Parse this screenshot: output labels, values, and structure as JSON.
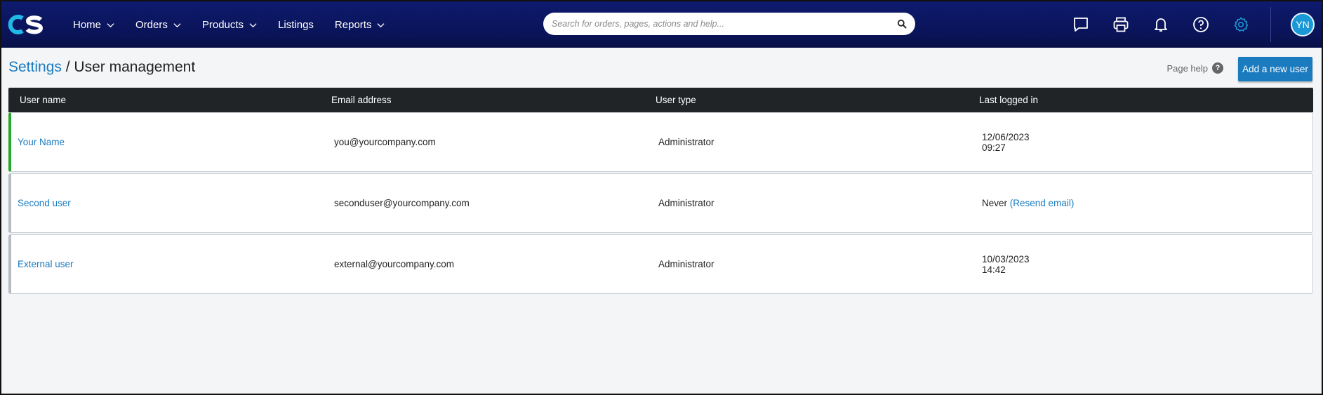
{
  "nav": {
    "items": [
      {
        "label": "Home",
        "has_dropdown": true
      },
      {
        "label": "Orders",
        "has_dropdown": true
      },
      {
        "label": "Products",
        "has_dropdown": true
      },
      {
        "label": "Listings",
        "has_dropdown": false
      },
      {
        "label": "Reports",
        "has_dropdown": true
      }
    ],
    "search_placeholder": "Search for orders, pages, actions and help...",
    "avatar_initials": "YN"
  },
  "header": {
    "breadcrumb_parent": "Settings",
    "separator": " / ",
    "title": "User management",
    "page_help_label": "Page help",
    "add_button_label": "Add a new user"
  },
  "table": {
    "columns": [
      "User name",
      "Email address",
      "User type",
      "Last logged in"
    ],
    "rows": [
      {
        "name": "Your Name",
        "email": "you@yourcompany.com",
        "type": "Administrator",
        "last_date": "12/06/2023",
        "last_time": "09:27",
        "status": "active"
      },
      {
        "name": "Second user",
        "email": "seconduser@yourcompany.com",
        "type": "Administrator",
        "last_text": "Never",
        "resend": "(Resend email)",
        "status": "inactive"
      },
      {
        "name": "External user",
        "email": "external@yourcompany.com",
        "type": "Administrator",
        "last_date": "10/03/2023",
        "last_time": "14:42",
        "status": "inactive"
      }
    ]
  },
  "colors": {
    "navbar": "#0a1458",
    "accent": "#1a7bbf",
    "active_border": "#27a82a",
    "table_header": "#202427",
    "gear_active": "#1a98d6"
  }
}
